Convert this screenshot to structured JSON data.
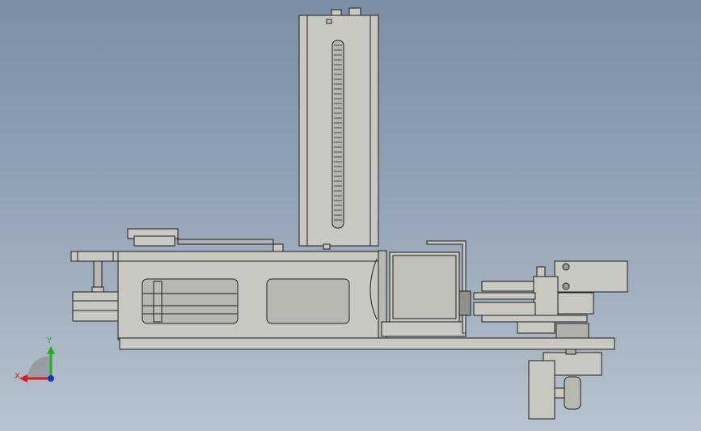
{
  "app": {
    "view": "Front"
  },
  "triad": {
    "x_label": "X",
    "y_label": "Y",
    "x_color": "#e01a1a",
    "y_color": "#18b818",
    "z_color": "#1a2ee0"
  },
  "colors": {
    "part_fill": "#c8c8c0",
    "part_fill_dark": "#a8a8a0",
    "edge": "#1e1e1e"
  },
  "parts": [
    "vertical-column",
    "rack-slot",
    "top-plate",
    "base-frame",
    "frame-window-left",
    "frame-window-right",
    "left-platform",
    "motor-block",
    "gripper-assembly",
    "wheel-bracket",
    "bottom-rail"
  ]
}
